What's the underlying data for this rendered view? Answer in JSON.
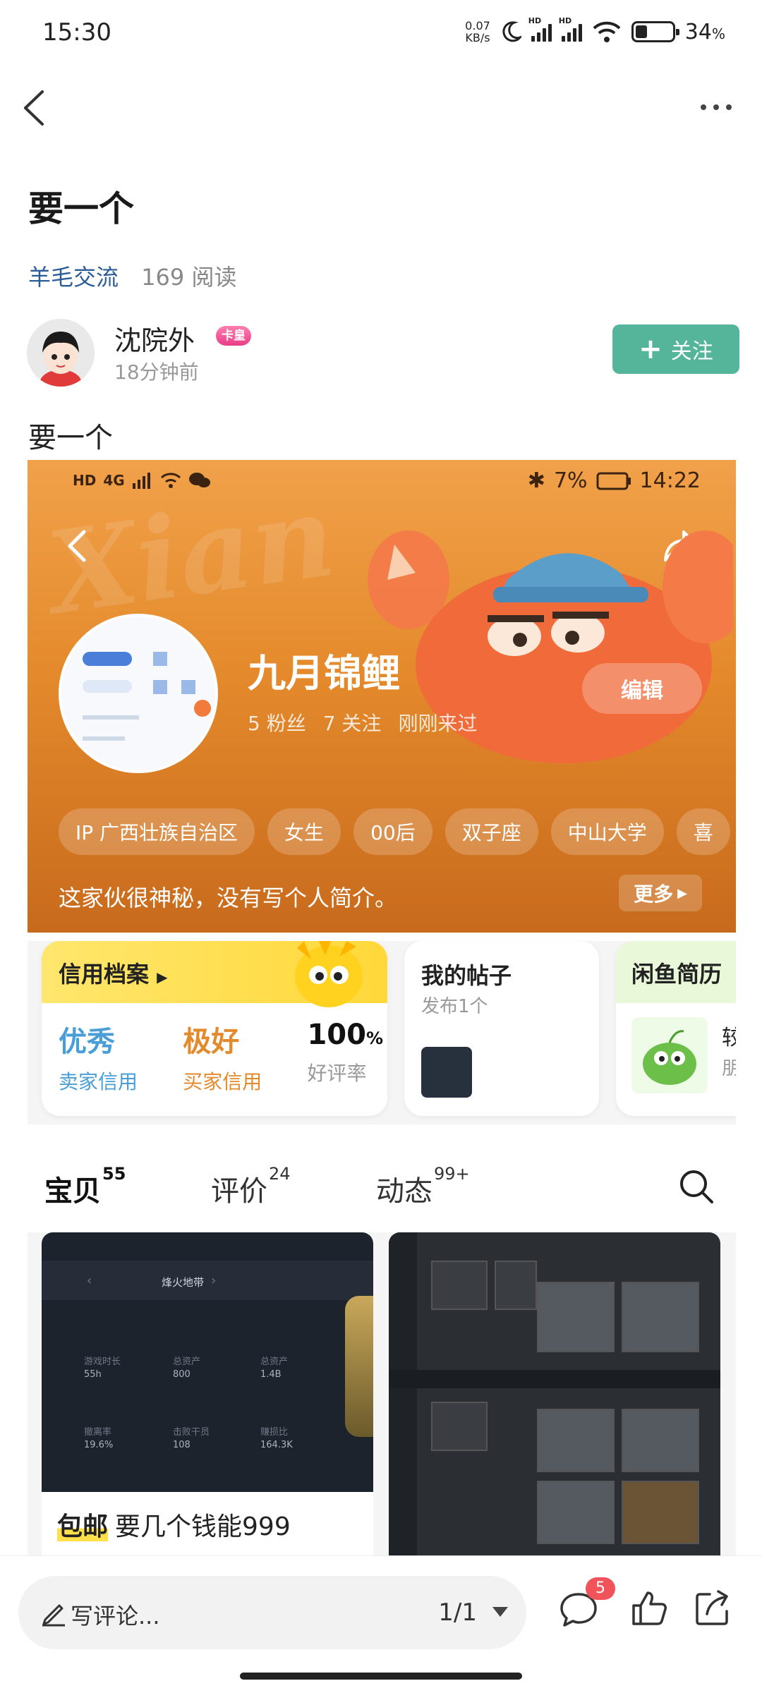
{
  "status_bar": {
    "time": "15:30",
    "net_speed_value": "0.07",
    "net_speed_unit": "KB/s",
    "battery_percent": "34",
    "battery_unit": "%",
    "signal_label": "HD"
  },
  "post": {
    "title": "要一个",
    "category": "羊毛交流",
    "reads": "169 阅读",
    "body": "要一个"
  },
  "author": {
    "name": "沈院外",
    "badge": "卡皇",
    "time": "18分钟前",
    "follow_label": "关注"
  },
  "embedded": {
    "status": {
      "left_label": "HD",
      "network": "4G",
      "battery": "7%",
      "time": "14:22"
    },
    "profile": {
      "name": "九月锦鲤",
      "fans": "5 粉丝",
      "following": "7 关注",
      "last_seen": "刚刚来过",
      "edit_label": "编辑",
      "tags": [
        "IP 广西壮族自治区",
        "女生",
        "00后",
        "双子座",
        "中山大学",
        "喜"
      ],
      "bio": "这家伙很神秘，没有写个人简介。",
      "more_label": "更多"
    },
    "credit_card": {
      "title": "信用档案",
      "seller_value": "优秀",
      "seller_label": "卖家信用",
      "buyer_value": "极好",
      "buyer_label": "买家信用",
      "rate_value": "100",
      "rate_unit": "%",
      "rate_label": "好评率"
    },
    "posts_card": {
      "title": "我的帖子",
      "subtitle": "发布1个"
    },
    "resume_card": {
      "title": "闲鱼简历",
      "line1": "较",
      "line2": "朋"
    },
    "tabs": [
      {
        "label": "宝贝",
        "count": "55"
      },
      {
        "label": "评价",
        "count": "24"
      },
      {
        "label": "动态",
        "count": "99+"
      }
    ],
    "items": [
      {
        "tag": "包邮",
        "title": "要几个钱能999"
      }
    ],
    "game_screen": {
      "header": "烽火地带",
      "stats": [
        {
          "label": "游戏时长",
          "value": "55h"
        },
        {
          "label": "总资产",
          "value": "800"
        },
        {
          "label": "总资产",
          "value": "1.4B"
        },
        {
          "label": "撤离率",
          "value": "19.6%"
        },
        {
          "label": "击败干员",
          "value": "108"
        },
        {
          "label": "赚损比",
          "value": "164.3K"
        }
      ]
    }
  },
  "bottom_bar": {
    "comment_placeholder": "写评论...",
    "pager": "1/1",
    "comment_badge": "5"
  },
  "colors": {
    "accent_green": "#55b59a",
    "category_blue": "#2a5d98",
    "hero_orange": "#e48a2c",
    "badge_red": "#f0535a"
  }
}
